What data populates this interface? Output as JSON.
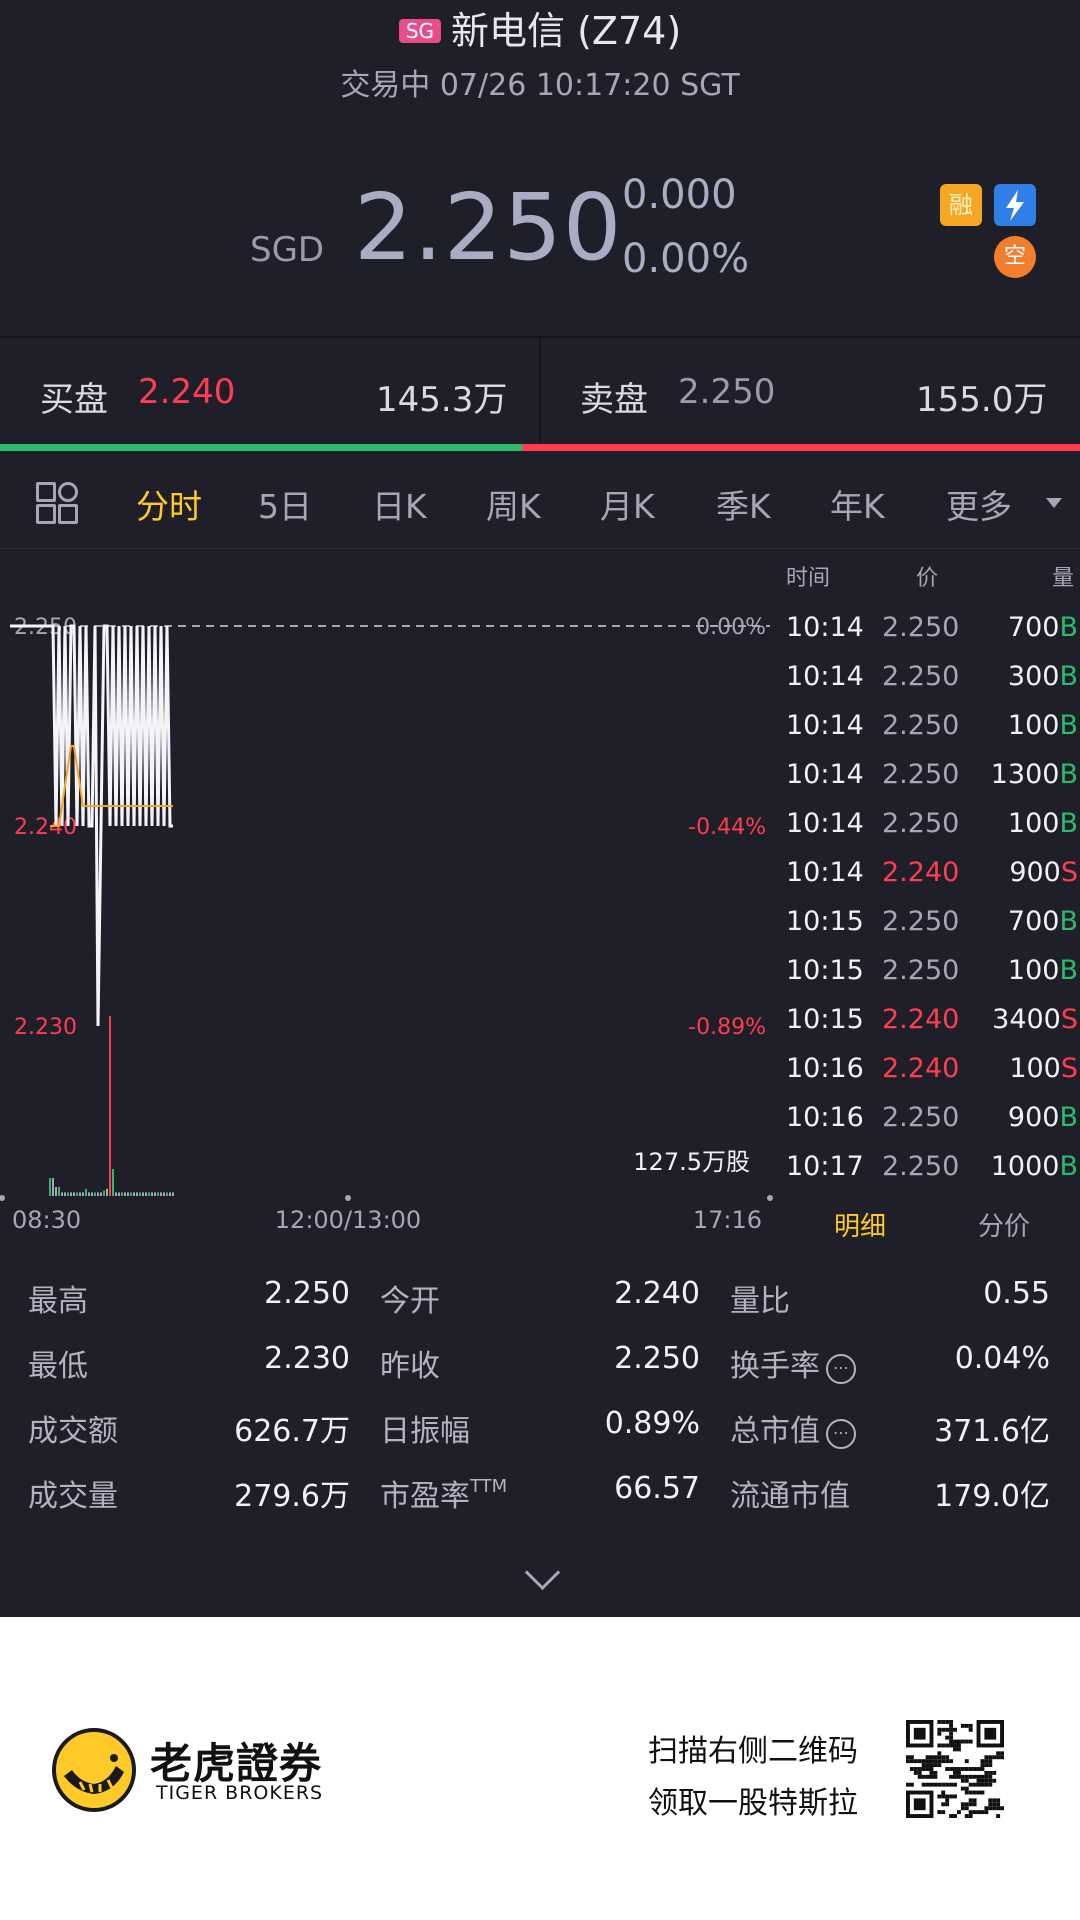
{
  "header": {
    "market_badge": "SG",
    "stock_name": "新电信 (Z74)",
    "status_line": "交易中 07/26 10:17:20 SGT"
  },
  "quote": {
    "currency": "SGD",
    "price": "2.250",
    "change": "0.000",
    "change_pct": "0.00%",
    "icons": [
      "margin-icon",
      "flash-icon",
      "short-icon"
    ],
    "icon_labels": {
      "margin": "融",
      "short": "空"
    }
  },
  "orderbook": {
    "bid_label": "买盘",
    "bid_price": "2.240",
    "bid_volume": "145.3万",
    "ask_label": "卖盘",
    "ask_price": "2.250",
    "ask_volume": "155.0万",
    "bid_ratio": 0.483
  },
  "tabs": [
    {
      "label": "分时",
      "active": true
    },
    {
      "label": "5日"
    },
    {
      "label": "日K"
    },
    {
      "label": "周K"
    },
    {
      "label": "月K"
    },
    {
      "label": "季K"
    },
    {
      "label": "年K"
    },
    {
      "label": "更多"
    }
  ],
  "chart_data": {
    "type": "line",
    "y_ticks": [
      {
        "value": "2.250",
        "pct": "0.00%"
      },
      {
        "value": "2.240",
        "pct": "-0.44%"
      },
      {
        "value": "2.230",
        "pct": "-0.89%"
      }
    ],
    "ylim": [
      2.23,
      2.25
    ],
    "x_labels": [
      "08:30",
      "12:00/13:00",
      "17:16"
    ],
    "volume_label": "127.5万股",
    "prev_close": 2.25,
    "price_series": [
      2.25,
      2.25,
      2.24,
      2.25,
      2.24,
      2.25,
      2.24,
      2.25,
      2.25,
      2.24,
      2.25,
      2.24,
      2.25,
      2.24,
      2.24,
      2.25,
      2.23,
      2.24,
      2.25,
      2.25,
      2.24,
      2.25,
      2.24,
      2.25,
      2.24,
      2.25,
      2.24,
      2.25,
      2.24,
      2.25,
      2.24,
      2.25,
      2.24,
      2.25,
      2.24,
      2.25,
      2.24,
      2.25,
      2.24,
      2.25,
      2.24,
      2.24
    ],
    "avg_series": [
      2.24,
      2.24,
      2.24,
      2.24,
      2.241,
      2.242,
      2.243,
      2.244,
      2.244,
      2.243,
      2.242,
      2.241,
      2.241,
      2.241,
      2.241,
      2.241,
      2.241,
      2.241,
      2.241,
      2.241,
      2.241,
      2.241,
      2.241,
      2.241,
      2.241,
      2.241,
      2.241,
      2.241,
      2.241,
      2.241,
      2.241,
      2.241,
      2.241,
      2.241,
      2.241,
      2.241,
      2.241,
      2.241,
      2.241,
      2.241,
      2.241,
      2.241
    ],
    "volume_series": [
      0.1,
      0.1,
      0.05,
      0.05,
      0.02,
      0.02,
      0.02,
      0.02,
      0.02,
      0.02,
      0.02,
      0.02,
      0.04,
      0.02,
      0.02,
      0.02,
      0.02,
      0.02,
      0.03,
      0.04,
      1.0,
      0.15,
      0.02,
      0.02,
      0.02,
      0.02,
      0.02,
      0.02,
      0.02,
      0.02,
      0.02,
      0.02,
      0.02,
      0.02,
      0.02,
      0.02,
      0.02,
      0.02,
      0.02,
      0.02,
      0.02,
      0.02
    ],
    "volume_colors": [
      "#ff3d50",
      "#2bbb6b"
    ]
  },
  "trades": {
    "headers": [
      "时间",
      "价",
      "量"
    ],
    "rows": [
      {
        "time": "10:14",
        "price": "2.250",
        "vol": "700",
        "side": "B"
      },
      {
        "time": "10:14",
        "price": "2.250",
        "vol": "300",
        "side": "B"
      },
      {
        "time": "10:14",
        "price": "2.250",
        "vol": "100",
        "side": "B"
      },
      {
        "time": "10:14",
        "price": "2.250",
        "vol": "1300",
        "side": "B"
      },
      {
        "time": "10:14",
        "price": "2.250",
        "vol": "100",
        "side": "B"
      },
      {
        "time": "10:14",
        "price": "2.240",
        "vol": "900",
        "side": "S"
      },
      {
        "time": "10:15",
        "price": "2.250",
        "vol": "700",
        "side": "B"
      },
      {
        "time": "10:15",
        "price": "2.250",
        "vol": "100",
        "side": "B"
      },
      {
        "time": "10:15",
        "price": "2.240",
        "vol": "3400",
        "side": "S"
      },
      {
        "time": "10:16",
        "price": "2.240",
        "vol": "100",
        "side": "S"
      },
      {
        "time": "10:16",
        "price": "2.250",
        "vol": "900",
        "side": "B"
      },
      {
        "time": "10:17",
        "price": "2.250",
        "vol": "1000",
        "side": "B"
      }
    ],
    "tab_detail": "明细",
    "tab_price": "分价"
  },
  "stats": [
    [
      {
        "label": "最高",
        "value": "2.250"
      },
      {
        "label": "今开",
        "value": "2.240"
      },
      {
        "label": "量比",
        "value": "0.55"
      }
    ],
    [
      {
        "label": "最低",
        "value": "2.230"
      },
      {
        "label": "昨收",
        "value": "2.250"
      },
      {
        "label": "换手率",
        "value": "0.04%",
        "info": true
      }
    ],
    [
      {
        "label": "成交额",
        "value": "626.7万"
      },
      {
        "label": "日振幅",
        "value": "0.89%"
      },
      {
        "label": "总市值",
        "value": "371.6亿",
        "info": true
      }
    ],
    [
      {
        "label": "成交量",
        "value": "279.6万"
      },
      {
        "label": "市盈率",
        "value": "66.57",
        "sup": "TTM"
      },
      {
        "label": "流通市值",
        "value": "179.0亿"
      }
    ]
  ],
  "footer": {
    "brand_cn": "老虎證券",
    "brand_en": "TIGER BROKERS",
    "promo_line1": "扫描右侧二维码",
    "promo_line2": "领取一股特斯拉"
  },
  "colors": {
    "background": "#1f1f29",
    "up": "#2bbb6b",
    "down": "#ff3d50",
    "accent": "#ffc928"
  }
}
